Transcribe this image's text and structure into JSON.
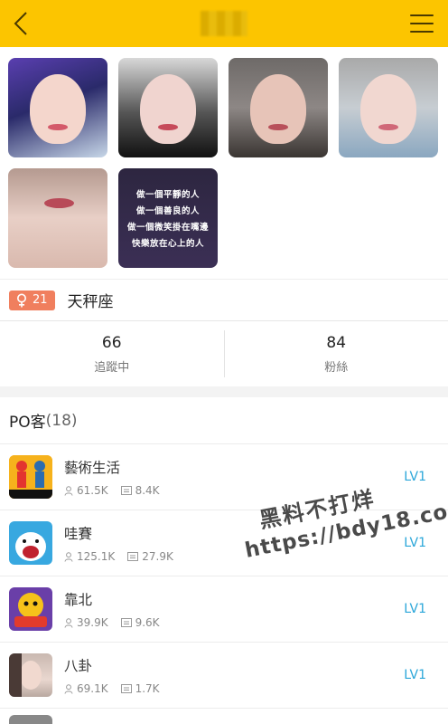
{
  "profile": {
    "zodiac_badge_age": "21",
    "zodiac": "天秤座",
    "stats": [
      {
        "value": "66",
        "label": "追蹤中"
      },
      {
        "value": "84",
        "label": "粉絲"
      }
    ]
  },
  "photo_text_lines": [
    "做一個平靜的人",
    "做一個善良的人",
    "做一個微笑掛在嘴邊",
    "快樂放在心上的人"
  ],
  "po_section": {
    "title": "PO客",
    "count": "(18)",
    "items": [
      {
        "name": "藝術生活",
        "views": "61.5K",
        "posts": "8.4K",
        "level": "LV1"
      },
      {
        "name": "哇賽",
        "views": "125.1K",
        "posts": "27.9K",
        "level": "LV1"
      },
      {
        "name": "靠北",
        "views": "39.9K",
        "posts": "9.6K",
        "level": "LV1"
      },
      {
        "name": "八卦",
        "views": "69.1K",
        "posts": "1.7K",
        "level": "LV1"
      }
    ]
  },
  "watermark": {
    "line1": "黑料不打烊",
    "line2": "https://bdy18.co"
  },
  "colors": {
    "topbar": "#fcc500",
    "badge": "#f07f5e",
    "level": "#2aa6d9"
  }
}
